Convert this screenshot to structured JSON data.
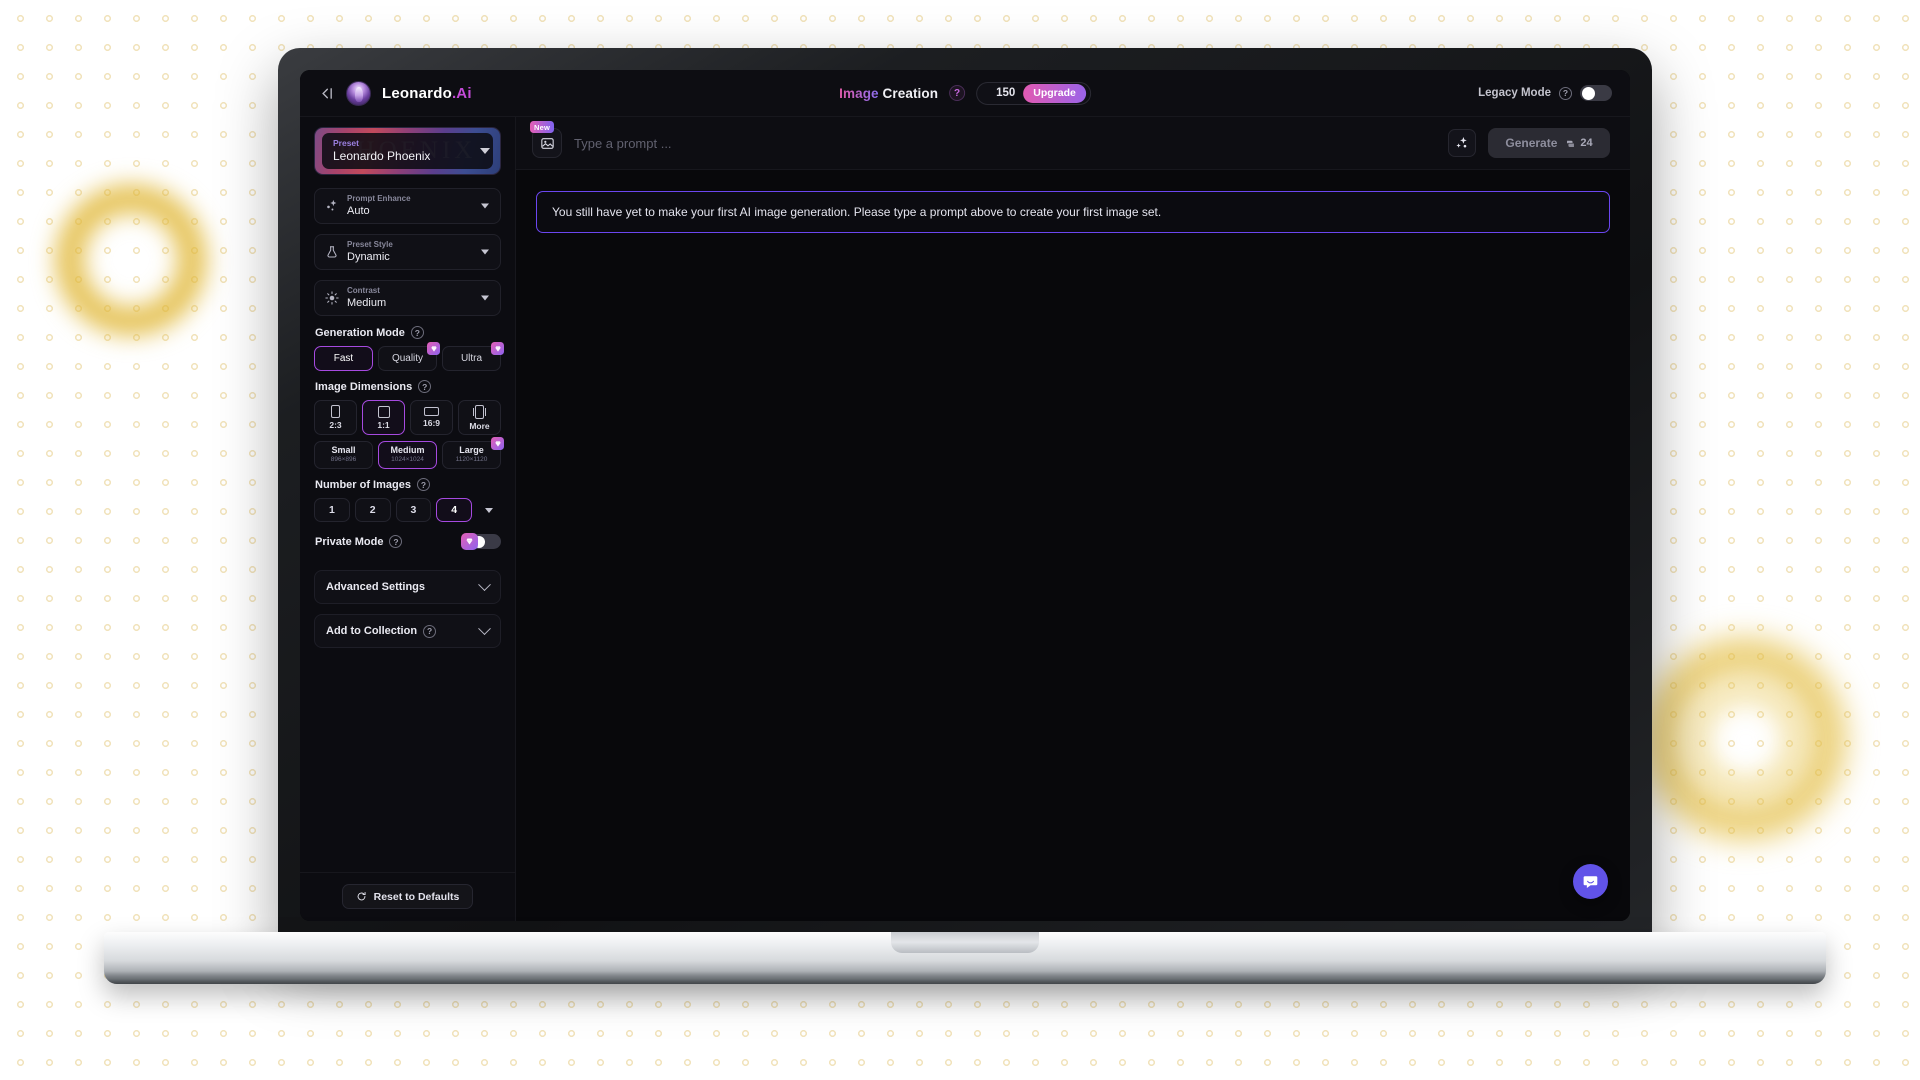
{
  "topbar": {
    "collapse_icon": "collapse-sidebar-icon",
    "brand_name": "Leonardo",
    "brand_suffix": ".Ai",
    "title_accent": "Image",
    "title_rest": "Creation",
    "title_help": "?",
    "credits": "150",
    "upgrade_label": "Upgrade",
    "legacy_label": "Legacy Mode",
    "legacy_help": "?",
    "legacy_enabled": false
  },
  "sidebar": {
    "preset": {
      "label": "Preset",
      "value": "Leonardo Phoenix",
      "art_word": "PHOENIX"
    },
    "selects": [
      {
        "label": "Prompt Enhance",
        "value": "Auto",
        "icon": "sparkles-icon"
      },
      {
        "label": "Preset Style",
        "value": "Dynamic",
        "icon": "flask-icon"
      },
      {
        "label": "Contrast",
        "value": "Medium",
        "icon": "brightness-icon"
      }
    ],
    "generation_mode": {
      "title": "Generation Mode",
      "help": "?",
      "options": [
        {
          "label": "Fast",
          "active": true,
          "premium": false
        },
        {
          "label": "Quality",
          "active": false,
          "premium": true
        },
        {
          "label": "Ultra",
          "active": false,
          "premium": true
        }
      ]
    },
    "image_dimensions": {
      "title": "Image Dimensions",
      "help": "?",
      "ratios": [
        {
          "label": "2:3",
          "active": false
        },
        {
          "label": "1:1",
          "active": true
        },
        {
          "label": "16:9",
          "active": false
        },
        {
          "label": "More",
          "active": false
        }
      ],
      "sizes": [
        {
          "name": "Small",
          "dims": "896×896",
          "active": false,
          "premium": false
        },
        {
          "name": "Medium",
          "dims": "1024×1024",
          "active": true,
          "premium": false
        },
        {
          "name": "Large",
          "dims": "1120×1120",
          "active": false,
          "premium": true
        }
      ]
    },
    "number_of_images": {
      "title": "Number of Images",
      "help": "?",
      "options": [
        {
          "label": "1",
          "active": false
        },
        {
          "label": "2",
          "active": false
        },
        {
          "label": "3",
          "active": false
        },
        {
          "label": "4",
          "active": true
        }
      ]
    },
    "private_mode": {
      "title": "Private Mode",
      "help": "?",
      "enabled": false
    },
    "accordions": [
      {
        "title": "Advanced Settings",
        "help": null
      },
      {
        "title": "Add to Collection",
        "help": "?"
      }
    ],
    "reset_label": "Reset to Defaults"
  },
  "main": {
    "prompt_placeholder": "Type a prompt ...",
    "prompt_value": "",
    "new_badge": "New",
    "image_button_icon": "image-icon",
    "enhance_icon": "sparkles-icon",
    "generate_label": "Generate",
    "generate_cost": "24",
    "empty_state": "You still have yet to make your first AI image generation. Please type a prompt above to create your first image set.",
    "support_icon": "chat-bubble-icon"
  },
  "colors": {
    "accent_purple": "#a64ae0",
    "accent_pink": "#e15ab2",
    "brand_suffix": "#c44bd8",
    "empty_border": "#6b46f0",
    "fab": "#6153e8",
    "decor_gold": "#dfb42d"
  }
}
